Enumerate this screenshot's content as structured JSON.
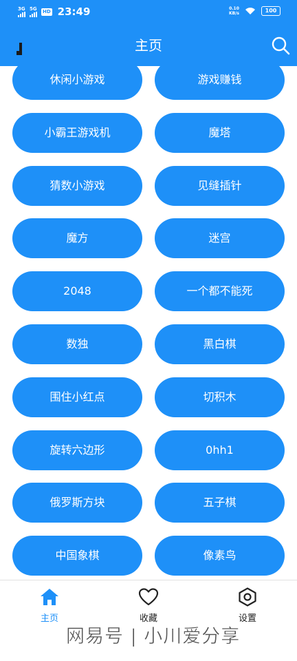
{
  "status_bar": {
    "signal_1": "3G",
    "signal_2": "5G",
    "hd": "HD",
    "time": "23:49",
    "netspeed_value": "0.10",
    "netspeed_unit": "KB/s",
    "battery": "100"
  },
  "header": {
    "title": "主页",
    "bg_color": "#1e90f8",
    "left_icon": "drawer-handle-icon",
    "right_icon": "search-icon"
  },
  "games": [
    [
      "休闲小游戏",
      "游戏赚钱"
    ],
    [
      "小霸王游戏机",
      "魔塔"
    ],
    [
      "猜数小游戏",
      "见缝插针"
    ],
    [
      "魔方",
      "迷宫"
    ],
    [
      "2048",
      "一个都不能死"
    ],
    [
      "数独",
      "黑白棋"
    ],
    [
      "围住小红点",
      "切积木"
    ],
    [
      "旋转六边形",
      "0hh1"
    ],
    [
      "俄罗斯方块",
      "五子棋"
    ],
    [
      "中国象棋",
      "像素鸟"
    ]
  ],
  "bottom_nav": {
    "items": [
      {
        "label": "主页",
        "icon": "home-icon",
        "active": true
      },
      {
        "label": "收藏",
        "icon": "heart-icon",
        "active": false
      },
      {
        "label": "设置",
        "icon": "settings-icon",
        "active": false
      }
    ]
  },
  "watermark": "网易号 | 小川爱分享",
  "colors": {
    "accent": "#1e90f8",
    "background": "#ffffff"
  }
}
